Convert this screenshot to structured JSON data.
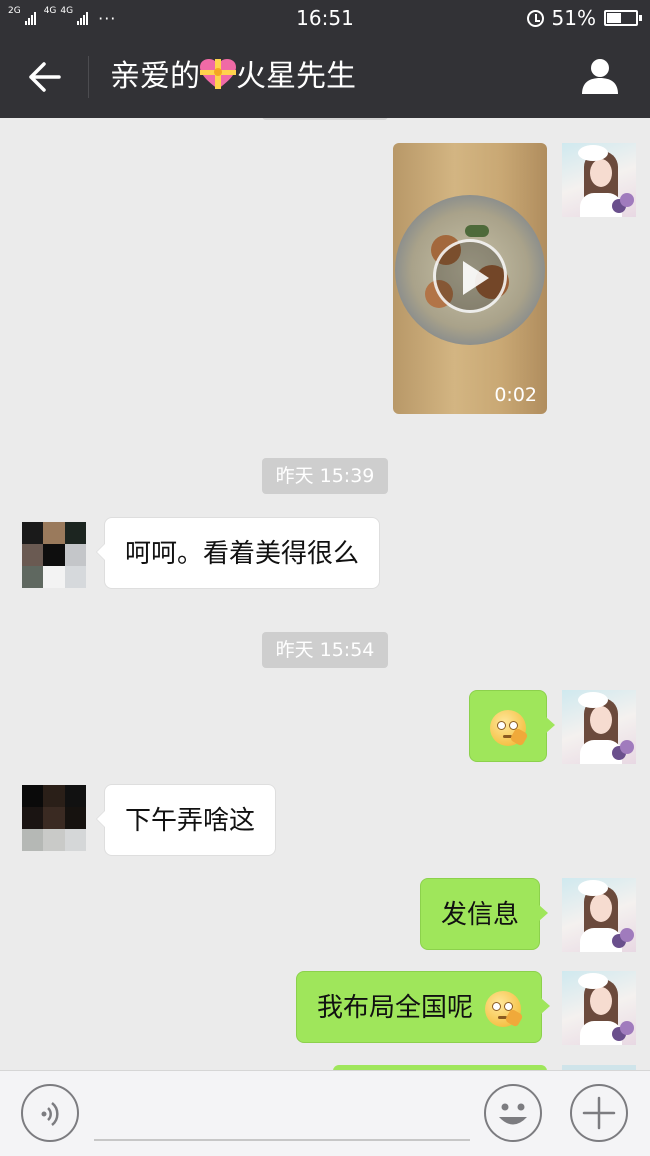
{
  "status_bar": {
    "network_left": "2G",
    "network_mid": "4G",
    "network_right": "4G",
    "dots": "···",
    "time": "16:51",
    "battery_text": "51%",
    "battery_level": 0.51
  },
  "header": {
    "back_icon": "back-arrow-icon",
    "title_part1": "亲爱的",
    "title_emoji": "gift-heart-emoji",
    "title_part2": "火星先生",
    "profile_icon": "person-icon",
    "bg_color": "#323236"
  },
  "messages": [
    {
      "type": "video",
      "from": "me",
      "duration": "0:02"
    },
    {
      "type": "timestamp",
      "text": "昨天 15:39"
    },
    {
      "type": "text",
      "from": "other",
      "text": "呵呵。看着美得很么"
    },
    {
      "type": "timestamp",
      "text": "昨天 15:54"
    },
    {
      "type": "emoji",
      "from": "me",
      "emoji": "thinking-face-emoji"
    },
    {
      "type": "text",
      "from": "other",
      "text": "下午弄啥这"
    },
    {
      "type": "text",
      "from": "me",
      "text": "发信息"
    },
    {
      "type": "text",
      "from": "me",
      "text": "我布局全国呢",
      "emoji": "thinking-face-emoji"
    }
  ],
  "input_bar": {
    "voice_icon": "voice-icon",
    "emoji_icon": "smiley-icon",
    "plus_icon": "plus-icon"
  },
  "colors": {
    "chat_bg": "#ebebeb",
    "outgoing_bubble": "#9fe65b",
    "incoming_bubble": "#ffffff",
    "timestamp_bg": "#cecece"
  }
}
